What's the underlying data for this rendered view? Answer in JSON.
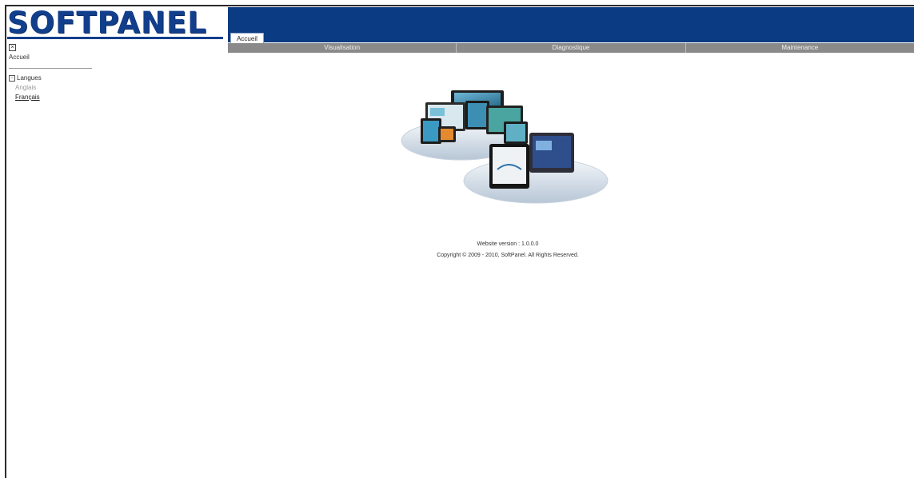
{
  "brand": {
    "logo_text": "SOFTPANEL"
  },
  "header": {
    "home_tab": "Accueil"
  },
  "nav": {
    "items": [
      "Visualisation",
      "Diagnostique",
      "Maintenance"
    ]
  },
  "sidebar": {
    "home": "Accueil",
    "languages_label": "Langues",
    "languages": [
      "Anglais",
      "Français"
    ]
  },
  "main": {
    "version": "Website version : 1.0.0.0",
    "copyright": "Copyright © 2009 - 2010, SoftPanel. All Rights Reserved."
  },
  "icons": [
    "close-icon",
    "tree-collapse-icon"
  ],
  "colors": {
    "header_blue": "#0b3b82",
    "logo_blue": "#123f8c",
    "nav_gray": "#8a8a8a"
  }
}
